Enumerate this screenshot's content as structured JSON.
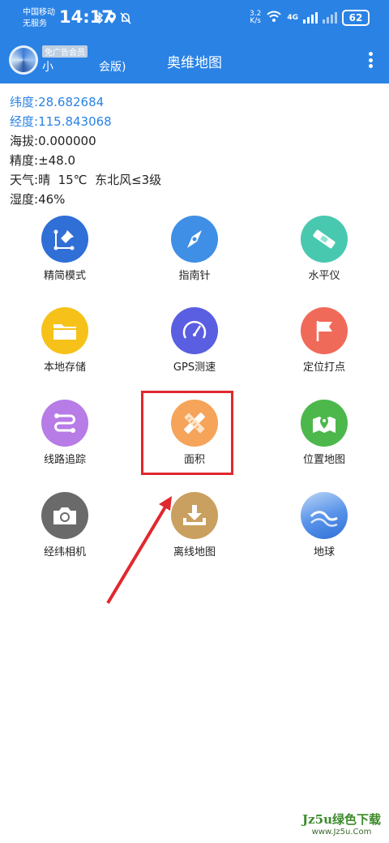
{
  "status_bar": {
    "carrier": "中国移动",
    "service": "无服务",
    "time": "14:17",
    "speed_value": "3.2",
    "speed_unit": "K/s",
    "network": "4G",
    "battery": "62"
  },
  "app_bar": {
    "vip_badge": "免广告会员",
    "username": "小　　　　会版)",
    "title": "奥维地图"
  },
  "info": {
    "latitude_label": "纬度:",
    "latitude": "28.682684",
    "longitude_label": "经度:",
    "longitude": "115.843068",
    "altitude_label": "海拔:",
    "altitude": "0.000000",
    "accuracy_label": "精度:",
    "accuracy": "±48.0",
    "weather_label": "天气:",
    "weather": "晴  15℃  东北风≤3级",
    "humidity_label": "湿度:",
    "humidity": "46%"
  },
  "tools": [
    {
      "label": "精简模式",
      "icon": "map-pin-icon",
      "color": "#2f6fd6"
    },
    {
      "label": "指南针",
      "icon": "compass-icon",
      "color": "#3f8fe6"
    },
    {
      "label": "水平仪",
      "icon": "level-icon",
      "color": "#49c8b0"
    },
    {
      "label": "本地存储",
      "icon": "folder-icon",
      "color": "#f6c21a"
    },
    {
      "label": "GPS测速",
      "icon": "speedometer-icon",
      "color": "#5a5ee0"
    },
    {
      "label": "定位打点",
      "icon": "flag-icon",
      "color": "#f06a5a"
    },
    {
      "label": "线路追踪",
      "icon": "route-icon",
      "color": "#b77ce6"
    },
    {
      "label": "面积",
      "icon": "ruler-pencil-icon",
      "color": "#f5a45a"
    },
    {
      "label": "位置地图",
      "icon": "location-map-icon",
      "color": "#4cb84c"
    },
    {
      "label": "经纬相机",
      "icon": "camera-icon",
      "color": "#6a6a6a"
    },
    {
      "label": "离线地图",
      "icon": "download-icon",
      "color": "#c9a060"
    },
    {
      "label": "地球",
      "icon": "earth-wave-icon",
      "color": "#2e6fd8"
    }
  ],
  "watermark": {
    "line1": "Jz5u绿色下载",
    "line2": "www.Jz5u.Com"
  }
}
